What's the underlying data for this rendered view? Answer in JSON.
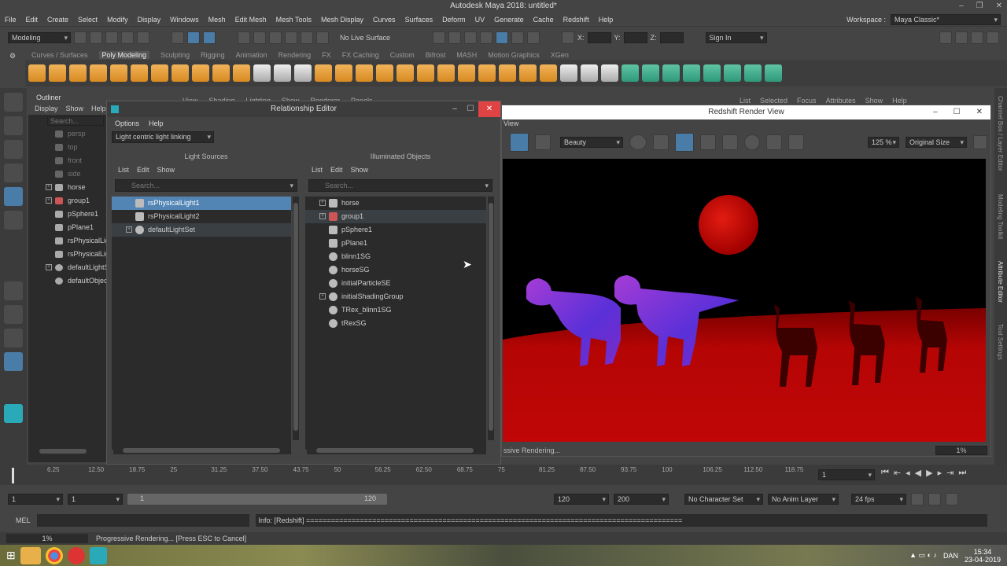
{
  "window": {
    "title": "Autodesk Maya 2018: untitled*"
  },
  "menubar": {
    "items": [
      "File",
      "Edit",
      "Create",
      "Select",
      "Modify",
      "Display",
      "Windows",
      "Mesh",
      "Edit Mesh",
      "Mesh Tools",
      "Mesh Display",
      "Curves",
      "Surfaces",
      "Deform",
      "UV",
      "Generate",
      "Cache",
      "Redshift",
      "Help"
    ],
    "workspace_label": "Workspace :",
    "workspace_value": "Maya Classic*"
  },
  "statusline": {
    "mode": "Modeling",
    "live_surface": "No Live Surface",
    "x_label": "X:",
    "y_label": "Y:",
    "z_label": "Z:",
    "sign_in": "Sign In"
  },
  "shelf": {
    "tabs": [
      "Curves / Surfaces",
      "Poly Modeling",
      "Sculpting",
      "Rigging",
      "Animation",
      "Rendering",
      "FX",
      "FX Caching",
      "Custom",
      "Bifrost",
      "MASH",
      "Motion Graphics",
      "XGen"
    ],
    "active_tab": "Poly Modeling"
  },
  "outliner": {
    "title": "Outliner",
    "menu": [
      "Display",
      "Show",
      "Help"
    ],
    "search_placeholder": "Search...",
    "items": [
      {
        "label": "persp",
        "dim": true
      },
      {
        "label": "top",
        "dim": true
      },
      {
        "label": "front",
        "dim": true
      },
      {
        "label": "side",
        "dim": true
      },
      {
        "label": "horse",
        "dim": false
      },
      {
        "label": "group1",
        "dim": false
      },
      {
        "label": "pSphere1",
        "dim": false
      },
      {
        "label": "pPlane1",
        "dim": false
      },
      {
        "label": "rsPhysicalLig",
        "dim": false
      },
      {
        "label": "rsPhysicalLig",
        "dim": false
      },
      {
        "label": "defaultLightS",
        "dim": false
      },
      {
        "label": "defaultObject",
        "dim": false
      }
    ]
  },
  "behind_menu": [
    "View",
    "Shading",
    "Lighting",
    "Show",
    "Renderer",
    "Panels"
  ],
  "behind_menu2": [
    "List",
    "Selected",
    "Focus",
    "Attributes",
    "Show",
    "Help"
  ],
  "relationship_editor": {
    "title": "Relationship Editor",
    "menu": [
      "Options",
      "Help"
    ],
    "mode": "Light centric light linking",
    "left_label": "Light Sources",
    "right_label": "Illuminated Objects",
    "pane_menu": [
      "List",
      "Edit",
      "Show"
    ],
    "search_placeholder": "Search...",
    "lights": [
      "rsPhysicalLight1",
      "rsPhysicalLight2",
      "defaultLightSet"
    ],
    "objects": [
      "horse",
      "group1",
      "pSphere1",
      "pPlane1",
      "blinn1SG",
      "horseSG",
      "initialParticleSE",
      "initialShadingGroup",
      "TRex_blinn1SG",
      "tRexSG"
    ]
  },
  "render_view": {
    "title": "Redshift Render View",
    "view_label": "View",
    "aov": "Beauty",
    "zoom": "125 %",
    "size": "Original Size",
    "status": "ssive Rendering...",
    "progress_pct": "1%"
  },
  "timeslider": {
    "ticks": [
      "6.25",
      "12.50",
      "18.75",
      "25",
      "31.25",
      "37.50",
      "43.75",
      "50",
      "56.25",
      "62.50",
      "68.75",
      "75",
      "81.25",
      "87.50",
      "93.75",
      "100",
      "106.25",
      "112.50",
      "118.75"
    ],
    "current_frame": "1"
  },
  "range": {
    "start": "1",
    "start2": "1",
    "slider_start": "1",
    "slider_end": "120",
    "end": "120",
    "end2": "200",
    "character_set": "No Character Set",
    "anim_layer": "No Anim Layer",
    "fps": "24 fps"
  },
  "mel": {
    "label": "MEL",
    "output": "Info:  [Redshift] ==========================================================================================="
  },
  "helpline": {
    "progress": "1%",
    "message": "Progressive Rendering... [Press ESC to Cancel]"
  },
  "taskbar": {
    "time": "15:34",
    "date": "23-04-2019",
    "lang": "DAN"
  },
  "right_dock": [
    "Channel Box / Layer Editor",
    "Modeling Toolkit",
    "Attribute Editor",
    "Tool Settings"
  ],
  "colors": {
    "accent": "#5285b4",
    "close": "#e04343",
    "render_floor": "#b00000",
    "sphere": "#d40d0d"
  }
}
